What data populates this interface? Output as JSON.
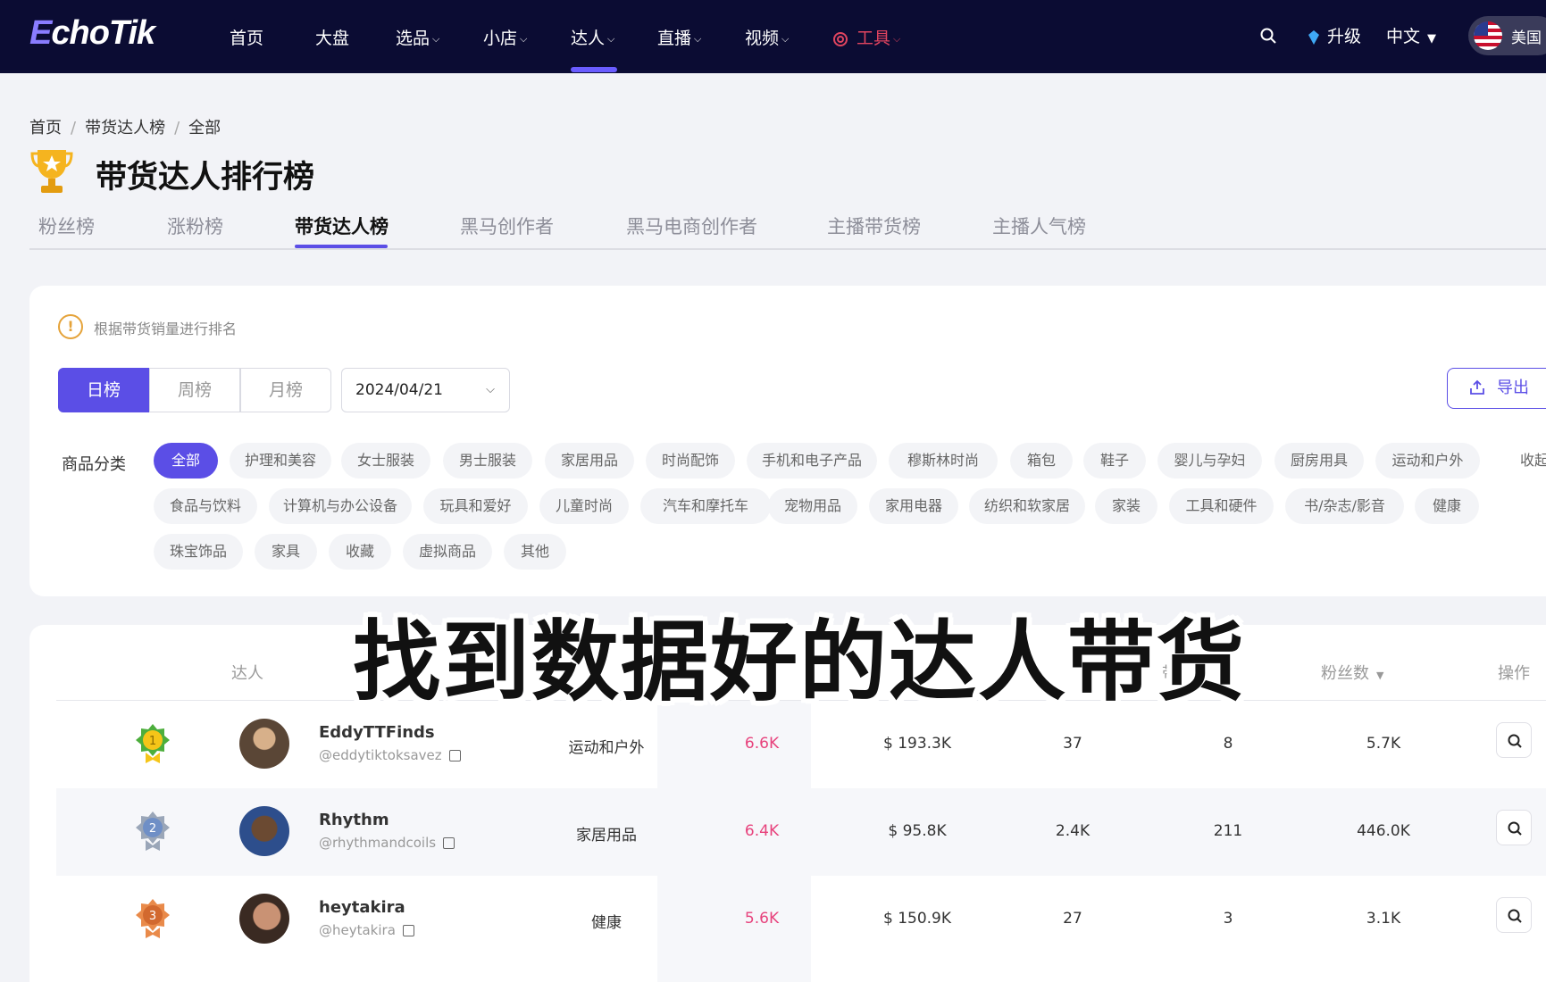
{
  "brand": {
    "logo_e": "E",
    "logo_rest": "choTik"
  },
  "nav": {
    "items": [
      "首页",
      "大盘",
      "选品",
      "小店",
      "达人",
      "直播",
      "视频"
    ],
    "tool_label": "工具",
    "upgrade": "升级",
    "language": "中文",
    "region": "美国"
  },
  "breadcrumb": [
    "首页",
    "带货达人榜",
    "全部"
  ],
  "page_title": "带货达人排行榜",
  "tabs": [
    "粉丝榜",
    "涨粉榜",
    "带货达人榜",
    "黑马创作者",
    "黑马电商创作者",
    "主播带货榜",
    "主播人气榜"
  ],
  "active_tab": "带货达人榜",
  "info_text": "根据带货销量进行排名",
  "period": {
    "options": [
      "日榜",
      "周榜",
      "月榜"
    ],
    "active": "日榜"
  },
  "date_value": "2024/04/21",
  "export_label": "导出",
  "category": {
    "label": "商品分类",
    "chips": [
      "全部",
      "护理和美容",
      "女士服装",
      "男士服装",
      "家居用品",
      "时尚配饰",
      "手机和电子产品",
      "穆斯林时尚",
      "箱包",
      "鞋子",
      "婴儿与孕妇",
      "厨房用具",
      "运动和户外",
      "收起",
      "食品与饮料",
      "计算机与办公设备",
      "玩具和爱好",
      "儿童时尚",
      "汽车和摩托车",
      "宠物用品",
      "家用电器",
      "纺织和软家居",
      "家装",
      "工具和硬件",
      "书/杂志/影音",
      "健康",
      "珠宝饰品",
      "家具",
      "收藏",
      "虚拟商品",
      "其他"
    ],
    "active": "全部"
  },
  "table": {
    "headers": {
      "creator": "达人",
      "followers": "粉丝数",
      "actions": "操作",
      "partial_1": "带"
    },
    "rows": [
      {
        "rank": "1",
        "name": "EddyTTFinds",
        "handle": "@eddytiktoksavez",
        "category": "运动和户外",
        "sales": "6.6K",
        "gmv": "$ 193.3K",
        "col5": "37",
        "col6": "8",
        "followers": "5.7K"
      },
      {
        "rank": "2",
        "name": "Rhythm",
        "handle": "@rhythmandcoils",
        "category": "家居用品",
        "sales": "6.4K",
        "gmv": "$ 95.8K",
        "col5": "2.4K",
        "col6": "211",
        "followers": "446.0K"
      },
      {
        "rank": "3",
        "name": "heytakira",
        "handle": "@heytakira",
        "category": "健康",
        "sales": "5.6K",
        "gmv": "$ 150.9K",
        "col5": "27",
        "col6": "3",
        "followers": "3.1K"
      }
    ]
  },
  "overlay_caption": "找到数据好的达人带货",
  "colors": {
    "nav_bg": "#0b0c33",
    "accent": "#5b4ee6",
    "pink": "#e7427c",
    "tool_red": "#e0445f"
  }
}
